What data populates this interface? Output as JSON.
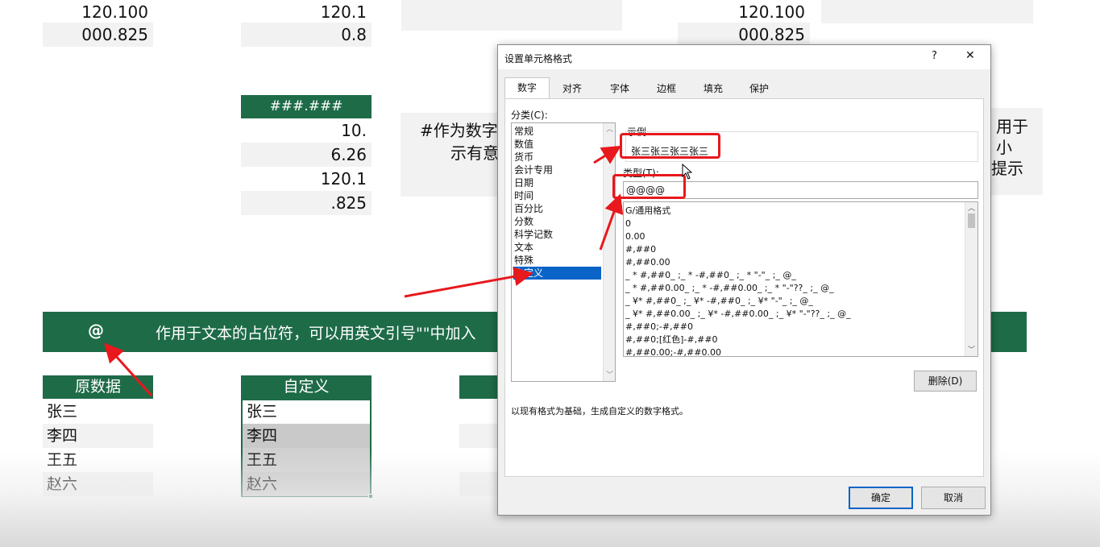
{
  "sheet": {
    "col1_top": [
      "120.100",
      "000.825"
    ],
    "col2_top": [
      "120.1",
      "0.8"
    ],
    "col4_top": [
      "120.100",
      "000.825"
    ],
    "hash_header": "###.###",
    "hash_values": [
      "10.",
      "6.26",
      "120.1",
      ".825"
    ],
    "note_left": [
      "#作为数字",
      "示有意"
    ],
    "note_right": [
      "用于小",
      "提示"
    ],
    "at_symbol": "@",
    "at_desc": "作用于文本的占位符，可以用英文引号\"\"中加入",
    "orig_header": "原数据",
    "custom_header": "自定义",
    "orig_values": [
      "张三",
      "李四",
      "王五",
      "赵六"
    ],
    "custom_values": [
      "张三",
      "李四",
      "王五",
      "赵六"
    ]
  },
  "dialog": {
    "title": "设置单元格格式",
    "help": "?",
    "close": "✕",
    "tabs": [
      "数字",
      "对齐",
      "字体",
      "边框",
      "填充",
      "保护"
    ],
    "category_label": "分类(C):",
    "categories": [
      "常规",
      "数值",
      "货币",
      "会计专用",
      "日期",
      "时间",
      "百分比",
      "分数",
      "科学记数",
      "文本",
      "特殊",
      "自定义"
    ],
    "selected_category": "自定义",
    "sample_label": "示例",
    "sample_value": "张三张三张三张三",
    "type_label": "类型(T):",
    "type_value": "@@@@",
    "formats": [
      "G/通用格式",
      "0",
      "0.00",
      "#,##0",
      "#,##0.00",
      "_ * #,##0_ ;_ * -#,##0_ ;_ * \"-\"_ ;_ @_",
      "_ * #,##0.00_ ;_ * -#,##0.00_ ;_ * \"-\"??_ ;_ @_",
      "_ ¥* #,##0_ ;_ ¥* -#,##0_ ;_ ¥* \"-\"_ ;_ @_",
      "_ ¥* #,##0.00_ ;_ ¥* -#,##0.00_ ;_ ¥* \"-\"??_ ;_ @_",
      "#,##0;-#,##0",
      "#,##0;[红色]-#,##0",
      "#,##0.00;-#,##0.00"
    ],
    "delete_button": "删除(D)",
    "description": "以现有格式为基础，生成自定义的数字格式。",
    "ok_button": "确定",
    "cancel_button": "取消"
  },
  "colors": {
    "excel_green": "#1e6b48",
    "annotation_red": "#e8181c",
    "selection_blue": "#0a64c8"
  }
}
